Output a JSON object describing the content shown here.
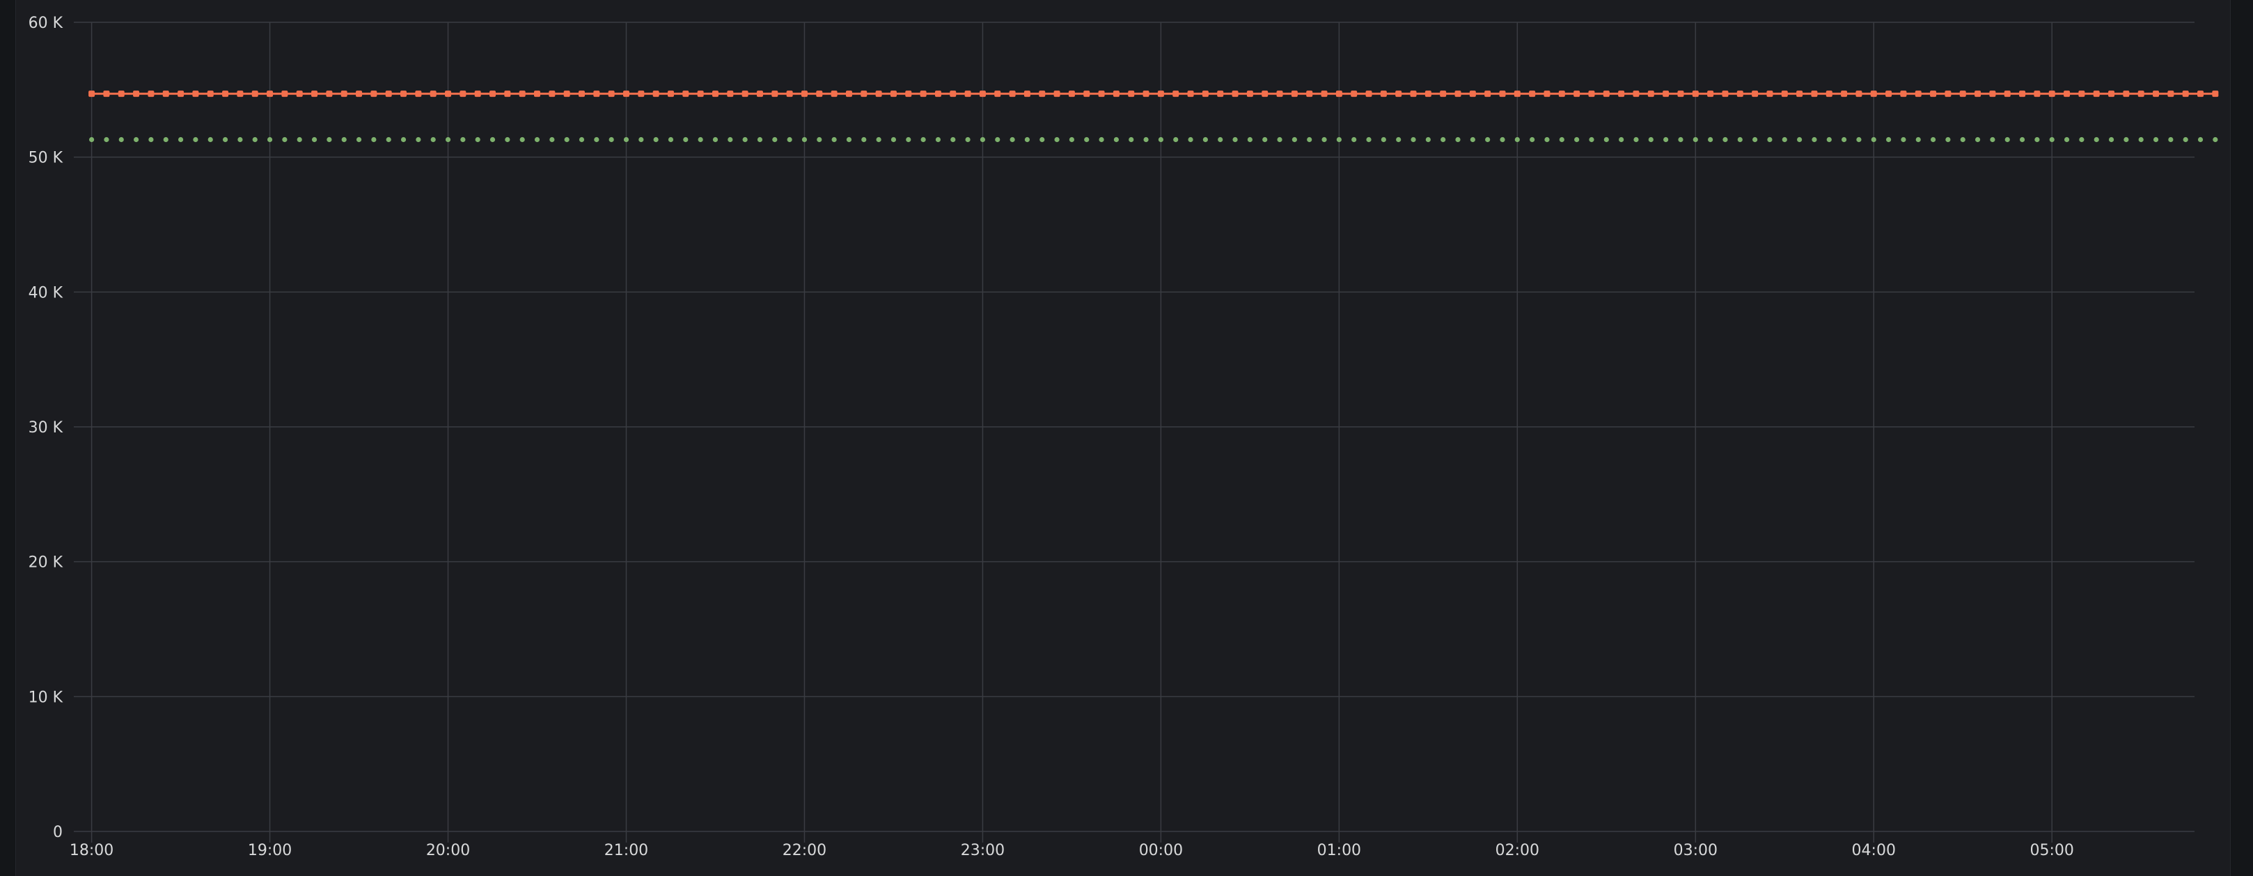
{
  "chart_data": {
    "type": "scatter",
    "y_ticks": [
      "0",
      "10 K",
      "20 K",
      "30 K",
      "40 K",
      "50 K",
      "60 K"
    ],
    "y_tick_values": [
      0,
      10000,
      20000,
      30000,
      40000,
      50000,
      60000
    ],
    "x_ticks": [
      "18:00",
      "19:00",
      "20:00",
      "21:00",
      "22:00",
      "23:00",
      "00:00",
      "01:00",
      "02:00",
      "03:00",
      "04:00",
      "05:00"
    ],
    "x_tick_values": [
      0,
      60,
      120,
      180,
      240,
      300,
      360,
      420,
      480,
      540,
      600,
      660
    ],
    "xlim": [
      -6,
      708
    ],
    "ylim": [
      0,
      60000
    ],
    "grid": true,
    "point_interval_minutes": 5,
    "point_count": 144,
    "series": [
      {
        "color": "#f2704d",
        "line": true,
        "marker": "square",
        "value": 54700
      },
      {
        "color": "#7eb26d",
        "line": false,
        "marker": "circle",
        "value": 51300
      }
    ]
  },
  "colors": {
    "background": "#141619",
    "panel": "#1b1c20",
    "grid": "#3a3c42",
    "text": "#d8d9da"
  }
}
